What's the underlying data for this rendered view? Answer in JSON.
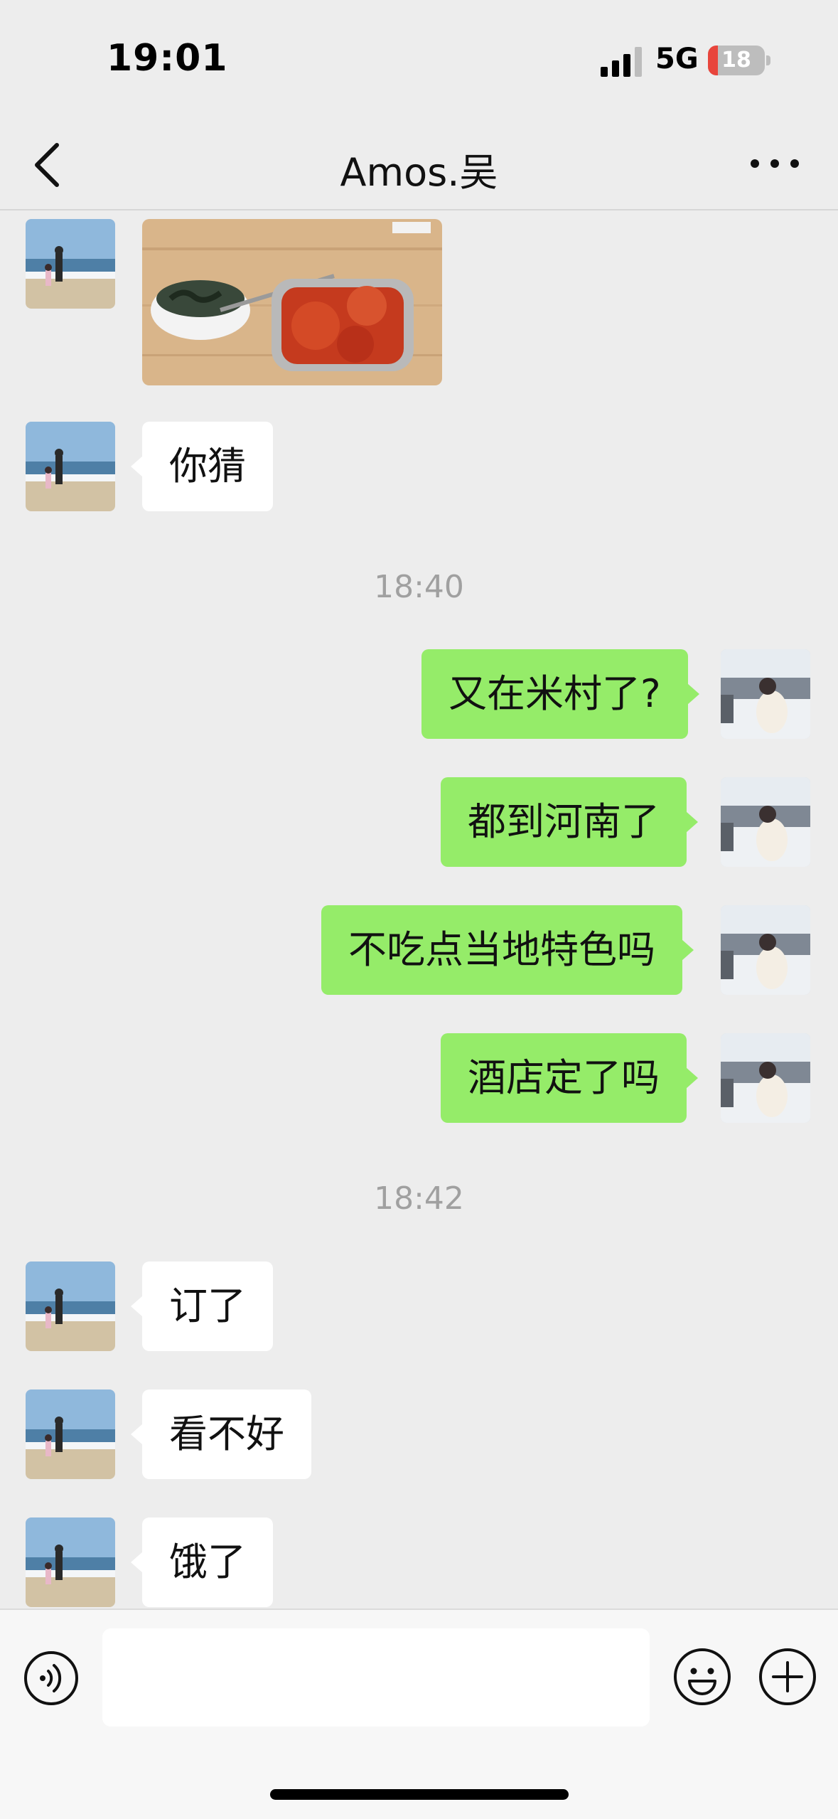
{
  "status_bar": {
    "time": "19:01",
    "network": "5G",
    "battery": "18",
    "battery_level": 0.18
  },
  "nav": {
    "title": "Amos.吴"
  },
  "messages": {
    "m_guess": "你猜",
    "time_1": "18:40",
    "m_michun": "又在米村了?",
    "m_henan": "都到河南了",
    "m_local": "不吃点当地特色吗",
    "m_hotel": "酒店定了吗",
    "time_2": "18:42",
    "m_booked": "订了",
    "m_bad": "看不好",
    "m_hungry": "饿了"
  },
  "colors": {
    "outgoing_bubble": "#95EC69",
    "incoming_bubble": "#FFFFFF",
    "background": "#EDEDED"
  },
  "icons": [
    "back-icon",
    "more-icon",
    "voice-icon",
    "emoji-icon",
    "plus-icon"
  ]
}
